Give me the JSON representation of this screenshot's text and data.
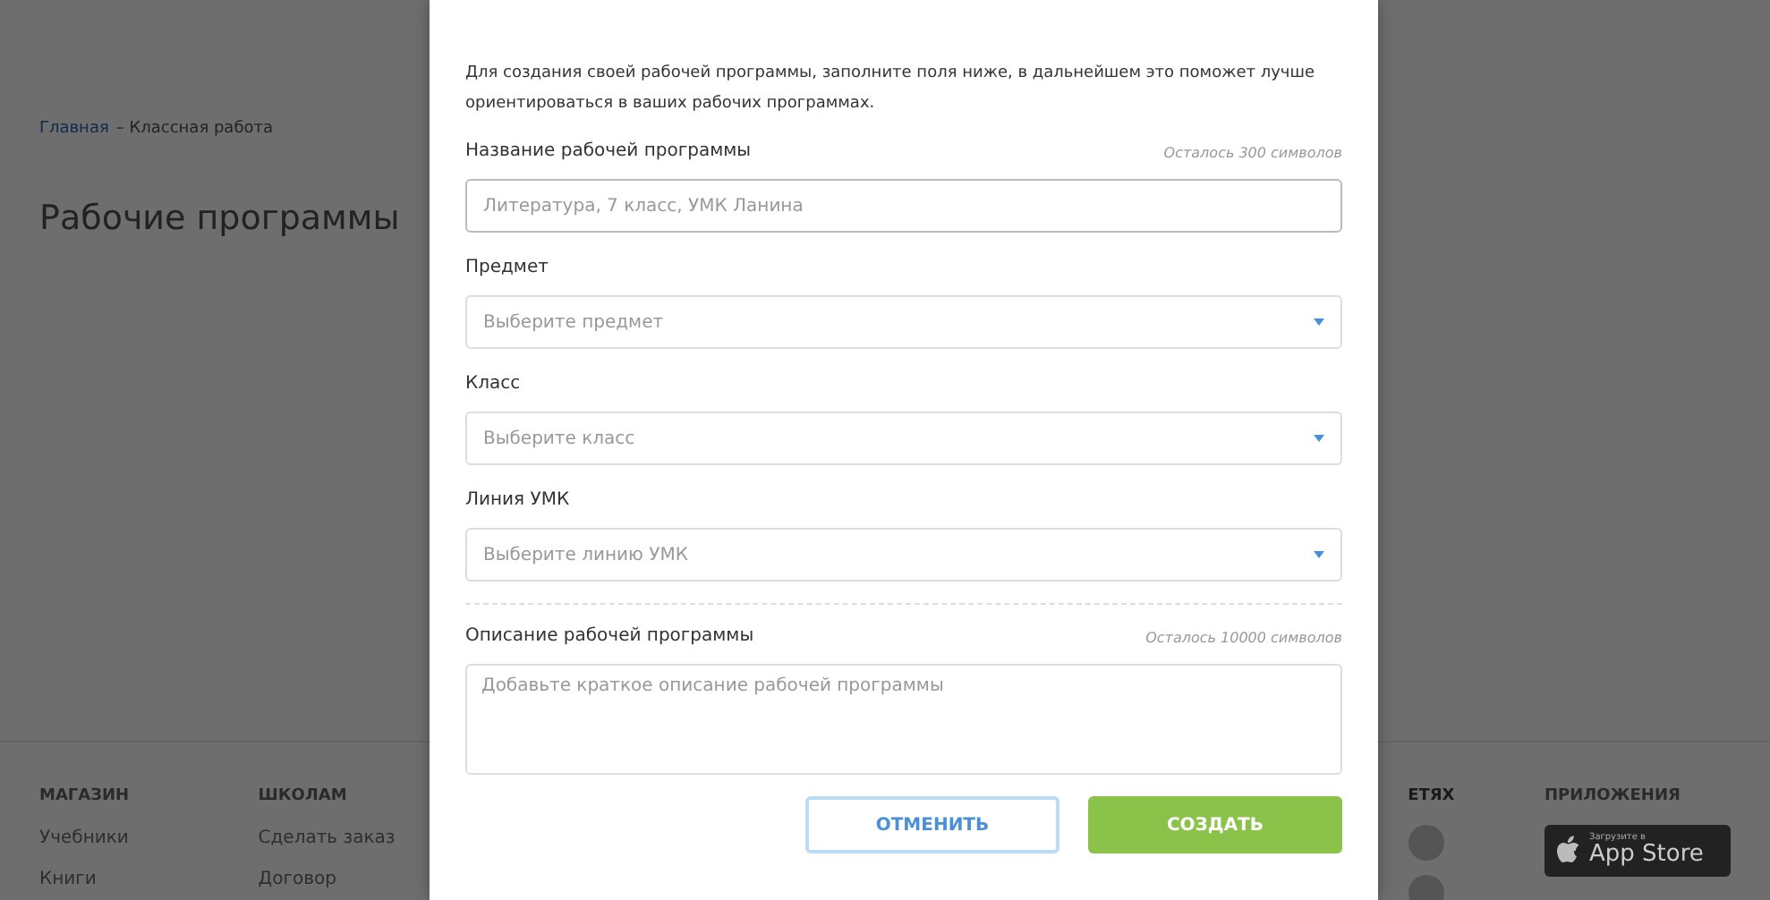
{
  "page": {
    "breadcrumb": [
      {
        "label": "Главная",
        "kind": "link"
      },
      {
        "label": "– Классная работа",
        "kind": "current"
      }
    ],
    "title": "Рабочие программы"
  },
  "footer": {
    "columns": [
      {
        "heading": "МАГАЗИН",
        "links": [
          "Учебники",
          "Книги"
        ]
      },
      {
        "heading": "ШКОЛАМ",
        "links": [
          "Сделать заказ",
          "Договор"
        ]
      }
    ],
    "social_heading": "ЕТЯХ",
    "apps_heading": "ПРИЛОЖЕНИЯ",
    "app_store": {
      "small": "Загрузите в",
      "big": "App Store"
    }
  },
  "modal": {
    "intro": "Для создания своей рабочей программы, заполните поля ниже, в дальнейшем это поможет лучше ориентироваться в ваших рабочих программах.",
    "fields": [
      {
        "kind": "text",
        "label": "Название рабочей программы",
        "counter": "Осталось 300 символов",
        "placeholder": "Литература, 7 класс, УМК Ланина"
      },
      {
        "kind": "select",
        "label": "Предмет",
        "placeholder": "Выберите предмет"
      },
      {
        "kind": "select",
        "label": "Класс",
        "placeholder": "Выберите класс"
      },
      {
        "kind": "select",
        "label": "Линия УМК",
        "placeholder": "Выберите линию УМК"
      },
      {
        "kind": "textarea",
        "label": "Описание рабочей программы",
        "counter": "Осталось 10000 символов",
        "placeholder": "Добавьте краткое описание рабочей программы"
      }
    ],
    "buttons": [
      {
        "kind": "secondary",
        "label": "ОТМЕНИТЬ"
      },
      {
        "kind": "primary",
        "label": "СОЗДАТЬ"
      }
    ]
  }
}
